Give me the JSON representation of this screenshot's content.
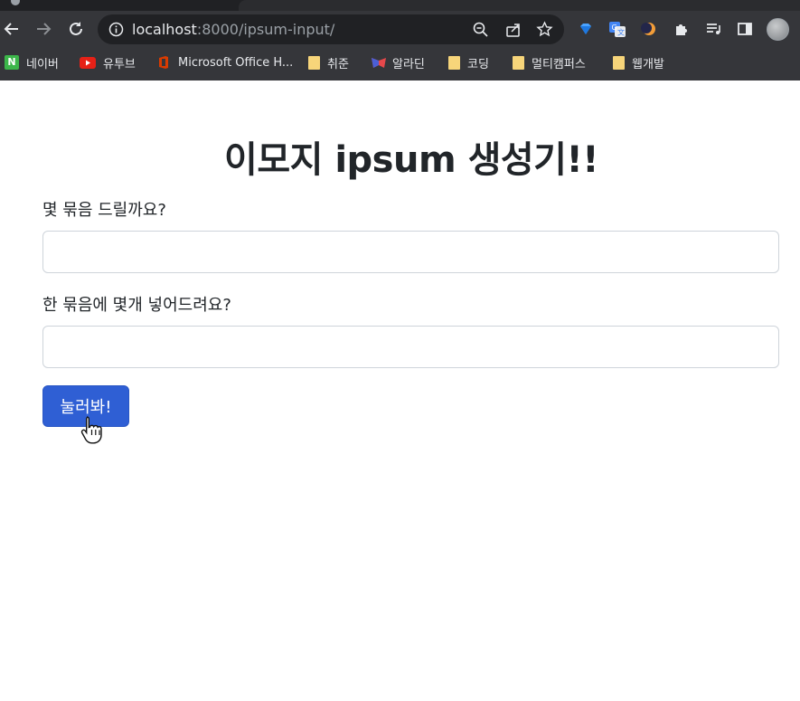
{
  "browser": {
    "url_host": "localhost",
    "url_rest": ":8000/ipsum-input/",
    "bookmarks": [
      {
        "label": "네이버",
        "icon": "naver-icon"
      },
      {
        "label": "유투브",
        "icon": "youtube-icon"
      },
      {
        "label": "Microsoft Office H...",
        "icon": "office-icon"
      },
      {
        "label": "취준",
        "icon": "folder-icon"
      },
      {
        "label": "알라딘",
        "icon": "aladin-icon"
      },
      {
        "label": "코딩",
        "icon": "folder-icon"
      },
      {
        "label": "멀티캠퍼스",
        "icon": "folder-icon"
      },
      {
        "label": "웹개발",
        "icon": "folder-icon"
      }
    ]
  },
  "page": {
    "title": "이모지 ipsum 생성기!!",
    "bundle_question": "몇 묶음 드릴까요?",
    "bundle_value": "",
    "count_question": "한 묶음에 몇개 넣어드려요?",
    "count_value": "",
    "submit_label": "눌러봐!"
  },
  "colors": {
    "button_bg": "#2f5fd4",
    "chrome_bg": "#35363a",
    "omnibox_bg": "#202124"
  }
}
